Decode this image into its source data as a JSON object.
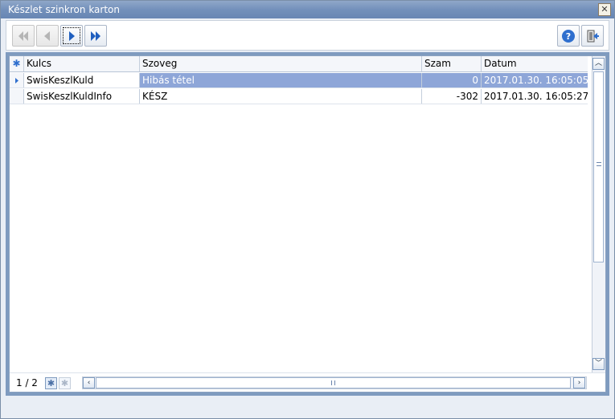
{
  "window": {
    "title": "Készlet szinkron karton",
    "close_glyph": "✕"
  },
  "toolbar": {
    "first_icon": "first-record-icon",
    "prev_icon": "previous-record-icon",
    "next_icon": "next-record-icon",
    "last_icon": "last-record-icon",
    "help_icon": "help-icon",
    "exit_icon": "exit-icon"
  },
  "grid": {
    "columns": [
      "Kulcs",
      "Szoveg",
      "Szam",
      "Datum"
    ],
    "rows": [
      {
        "kulcs": "SwisKeszlKuld",
        "szoveg": "Hibás tétel",
        "szam": "0",
        "datum": "2017.01.30. 16:05:05",
        "selected": true
      },
      {
        "kulcs": "SwisKeszlKuldInfo",
        "szoveg": "KÉSZ",
        "szam": "-302",
        "datum": "2017.01.30. 16:05:27",
        "selected": false
      }
    ]
  },
  "footer": {
    "record_position": "1 / 2"
  },
  "colors": {
    "title_bar": "#7390bb",
    "selection": "#8ea6d8",
    "accent_blue": "#1f5fbf"
  }
}
